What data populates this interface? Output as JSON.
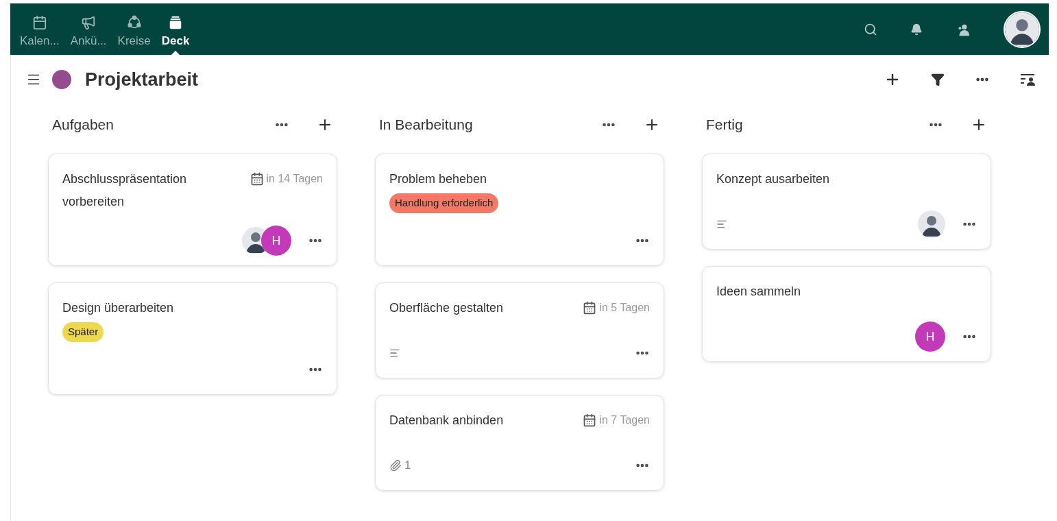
{
  "apps": [
    {
      "label": "Kalen...",
      "kind": "calendar",
      "selected": false
    },
    {
      "label": "Ankü...",
      "kind": "megaphone",
      "selected": false
    },
    {
      "label": "Kreise",
      "kind": "circles",
      "selected": false
    },
    {
      "label": "Deck",
      "kind": "deck",
      "selected": true
    }
  ],
  "board": {
    "title": "Projektarbeit",
    "color": "#944b8f"
  },
  "columns": [
    {
      "title": "Aufgaben",
      "cards": [
        {
          "title": "Abschlusspräsentation vorbereiten",
          "due": "in 14 Tagen",
          "assignees": [
            {
              "kind": "photo"
            },
            {
              "kind": "initial",
              "initial": "H",
              "color": "#c23ab8"
            }
          ]
        },
        {
          "title": "Design überarbeiten",
          "tags": [
            {
              "label": "Später",
              "color": "#ecd94f"
            }
          ]
        }
      ]
    },
    {
      "title": "In Bearbeitung",
      "cards": [
        {
          "title": "Problem beheben",
          "tags": [
            {
              "label": "Handlung erforderlich",
              "color": "#f27966"
            }
          ]
        },
        {
          "title": "Oberfläche gestalten",
          "due": "in 5 Tagen",
          "description": true
        },
        {
          "title": "Datenbank anbinden",
          "due": "in 7 Tagen",
          "attachments": "1"
        }
      ]
    },
    {
      "title": "Fertig",
      "cards": [
        {
          "title": "Konzept ausarbeiten",
          "description": true,
          "assignees": [
            {
              "kind": "photo"
            }
          ]
        },
        {
          "title": "Ideen sammeln",
          "assignees": [
            {
              "kind": "initial",
              "initial": "H",
              "color": "#c23ab8"
            }
          ]
        }
      ]
    }
  ]
}
